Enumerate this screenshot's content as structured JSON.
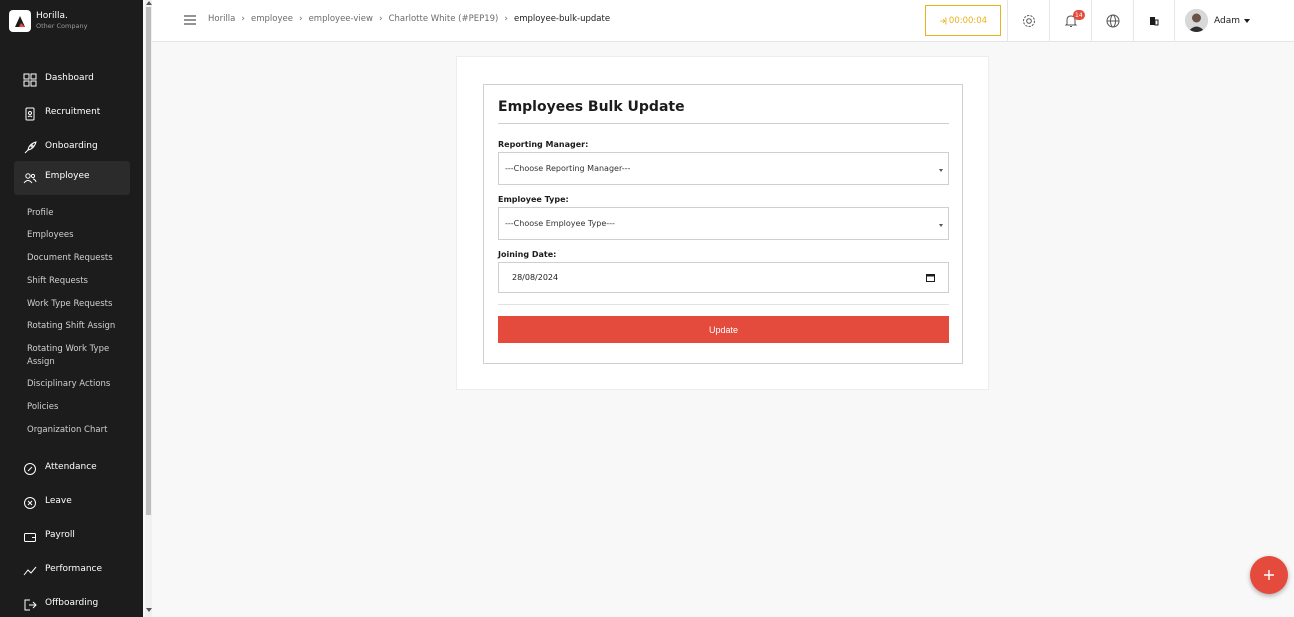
{
  "brand": {
    "name": "Horilla.",
    "company": "Other Company"
  },
  "sidebar": {
    "items": [
      {
        "label": "Dashboard",
        "icon": "dashboard-icon"
      },
      {
        "label": "Recruitment",
        "icon": "recruitment-icon"
      },
      {
        "label": "Onboarding",
        "icon": "rocket-icon"
      },
      {
        "label": "Employee",
        "icon": "people-icon",
        "active": true
      },
      {
        "label": "Attendance",
        "icon": "attendance-icon"
      },
      {
        "label": "Leave",
        "icon": "leave-icon"
      },
      {
        "label": "Payroll",
        "icon": "wallet-icon"
      },
      {
        "label": "Performance",
        "icon": "trend-icon"
      },
      {
        "label": "Offboarding",
        "icon": "exit-icon"
      }
    ],
    "sub_items": [
      "Profile",
      "Employees",
      "Document Requests",
      "Shift Requests",
      "Work Type Requests",
      "Rotating Shift Assign",
      "Rotating Work Type Assign",
      "Disciplinary Actions",
      "Policies",
      "Organization Chart"
    ]
  },
  "header": {
    "breadcrumbs": [
      "Horilla",
      "employee",
      "employee-view",
      "Charlotte White (#PEP19)",
      "employee-bulk-update"
    ],
    "timer": "00:00:04",
    "notification_count": "14",
    "user_name": "Adam"
  },
  "form": {
    "title": "Employees Bulk Update",
    "reporting_manager_label": "Reporting Manager:",
    "reporting_manager_value": "---Choose Reporting Manager---",
    "employee_type_label": "Employee Type:",
    "employee_type_value": "---Choose Employee Type---",
    "joining_date_label": "Joining Date:",
    "joining_date_value": "28/08/2024",
    "submit_label": "Update"
  },
  "colors": {
    "accent": "#e54b3c",
    "sidebar_bg": "#1c1c1c",
    "timer": "#e8b21c"
  }
}
